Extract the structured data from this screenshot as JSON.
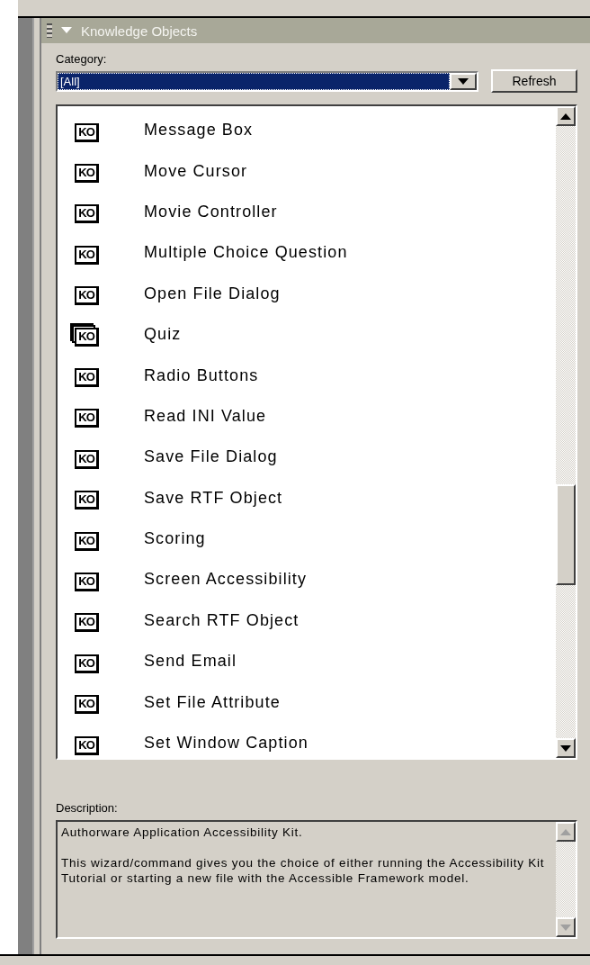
{
  "panel": {
    "title": "Knowledge Objects",
    "expanded": true
  },
  "category": {
    "label": "Category:",
    "value": "[All]",
    "button": "Refresh"
  },
  "items": [
    {
      "kind": "single",
      "badge": "KO",
      "name": "Message Box"
    },
    {
      "kind": "single",
      "badge": "KO",
      "name": "Move Cursor"
    },
    {
      "kind": "single",
      "badge": "KO",
      "name": "Movie Controller"
    },
    {
      "kind": "single",
      "badge": "KO",
      "name": "Multiple Choice Question"
    },
    {
      "kind": "single",
      "badge": "KO",
      "name": "Open File Dialog"
    },
    {
      "kind": "stack",
      "badge": "KO",
      "name": "Quiz"
    },
    {
      "kind": "single",
      "badge": "KO",
      "name": "Radio Buttons"
    },
    {
      "kind": "single",
      "badge": "KO",
      "name": "Read INI Value"
    },
    {
      "kind": "single",
      "badge": "KO",
      "name": "Save File Dialog"
    },
    {
      "kind": "single",
      "badge": "KO",
      "name": "Save RTF Object"
    },
    {
      "kind": "single",
      "badge": "KO",
      "name": "Scoring"
    },
    {
      "kind": "single",
      "badge": "KO",
      "name": "Screen Accessibility"
    },
    {
      "kind": "single",
      "badge": "KO",
      "name": "Search RTF Object"
    },
    {
      "kind": "single",
      "badge": "KO",
      "name": "Send Email"
    },
    {
      "kind": "single",
      "badge": "KO",
      "name": "Set File Attribute"
    },
    {
      "kind": "single",
      "badge": "KO",
      "name": "Set Window Caption"
    }
  ],
  "description": {
    "label": "Description:",
    "paragraphs": [
      "Authorware Application Accessibility Kit.",
      "This wizard/command gives you the choice of either running the Accessibility Kit Tutorial or starting a new file with the Accessible Framework model."
    ]
  }
}
